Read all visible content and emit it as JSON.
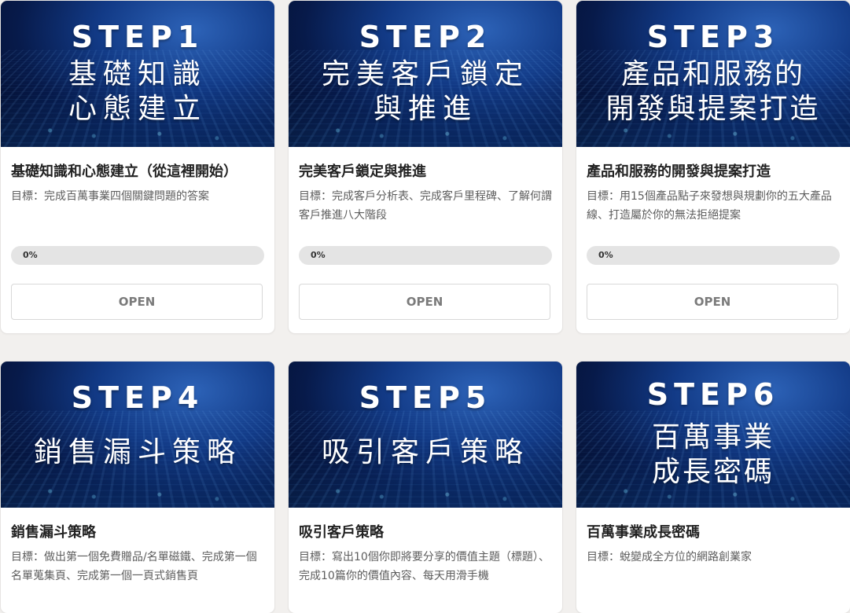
{
  "courses": [
    {
      "step": "STEP1",
      "thumb_lines": [
        "基礎知識",
        "心態建立"
      ],
      "title": "基礎知識和心態建立（從這裡開始）",
      "goal": "目標：完成百萬事業四個關鍵問題的答案",
      "progress": {
        "value": 0,
        "label": "0%"
      },
      "button": "OPEN"
    },
    {
      "step": "STEP2",
      "thumb_lines": [
        "完美客戶鎖定",
        "與推進"
      ],
      "title": "完美客戶鎖定與推進",
      "goal": "目標：完成客戶分析表、完成客戶里程碑、了解何謂客戶推進八大階段",
      "progress": {
        "value": 0,
        "label": "0%"
      },
      "button": "OPEN"
    },
    {
      "step": "STEP3",
      "thumb_lines": [
        "產品和服務的",
        "開發與提案打造"
      ],
      "title": "產品和服務的開發與提案打造",
      "goal": "目標：用15個產品點子來發想與規劃你的五大產品線、打造屬於你的無法拒絕提案",
      "progress": {
        "value": 0,
        "label": "0%"
      },
      "button": "OPEN"
    },
    {
      "step": "STEP4",
      "thumb_lines": [
        "銷售漏斗策略"
      ],
      "title": "銷售漏斗策略",
      "goal": "目標：做出第一個免費贈品/名單磁鐵、完成第一個名單蒐集頁、完成第一個一頁式銷售頁"
    },
    {
      "step": "STEP5",
      "thumb_lines": [
        "吸引客戶策略"
      ],
      "title": "吸引客戶策略",
      "goal": "目標：寫出10個你即將要分享的價值主題（標題）、完成10篇你的價值內容、每天用滑手機"
    },
    {
      "step": "STEP6",
      "thumb_lines": [
        "百萬事業",
        "成長密碼"
      ],
      "title": "百萬事業成長密碼",
      "goal": "目標：蛻變成全方位的網路創業家"
    }
  ],
  "colors": {
    "page_bg": "#f2f0ee",
    "card_bg": "#ffffff",
    "progress_track": "#e4e4e4",
    "progress_fill": "#2e8b57",
    "button_text": "#7b7b7b",
    "thumbnail_blue": "#123a86"
  }
}
